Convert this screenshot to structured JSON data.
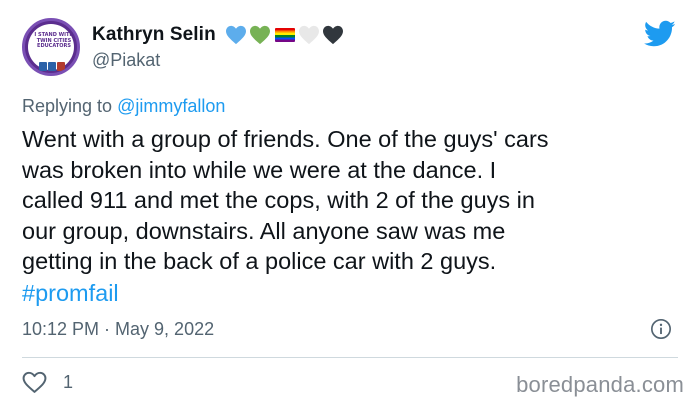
{
  "author": {
    "display_name": "Kathryn Selin",
    "handle": "@Piakat",
    "avatar_text": "I STAND WITH TWIN CITIES EDUCATORS",
    "name_emojis": [
      "blue-heart",
      "green-heart",
      "rainbow-flag",
      "white-heart",
      "black-heart"
    ]
  },
  "reply": {
    "prefix": "Replying to ",
    "mention": "@jimmyfallon"
  },
  "tweet": {
    "body": "Went with a group of friends. One of the guys' cars\nwas broken into while we were at the dance. I\ncalled 911 and met the cops, with 2 of the guys in\nour group, downstairs. All anyone saw was me\ngetting in the back of a police car with 2 guys.",
    "hashtag": "#promfail",
    "timestamp": "10:12 PM · May 9, 2022"
  },
  "actions": {
    "like_count": "1"
  },
  "watermark": "boredpanda.com",
  "colors": {
    "accent": "#1d9bf0",
    "secondary_text": "#536471",
    "primary_text": "#0f1419",
    "divider": "#cfd9de"
  },
  "icons": {
    "brand": "twitter-bird-icon",
    "info": "info-icon",
    "like": "heart-icon"
  }
}
